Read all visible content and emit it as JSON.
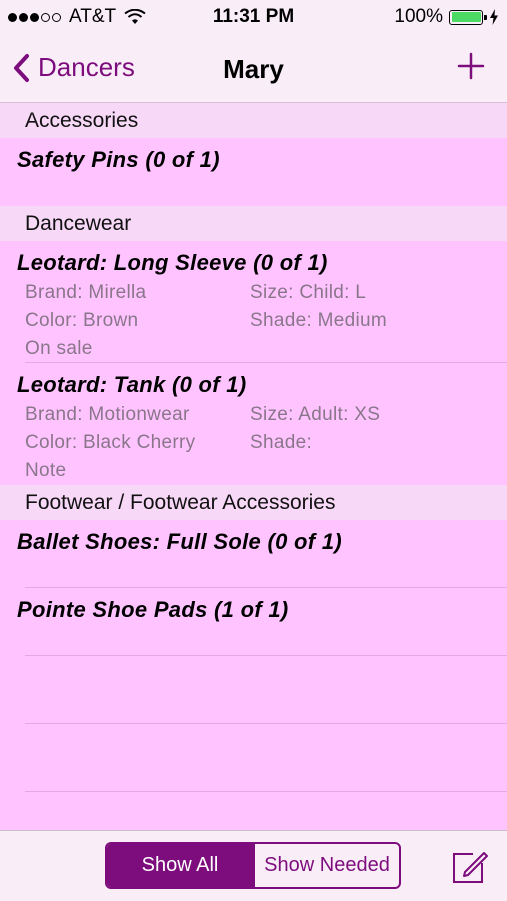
{
  "status_bar": {
    "carrier": "AT&T",
    "time": "11:31 PM",
    "battery": "100%",
    "battery_level": 1.0
  },
  "nav": {
    "back_label": "Dancers",
    "title": "Mary"
  },
  "sections": [
    {
      "header": "Accessories",
      "items": [
        {
          "title": "Safety Pins (0 of 1)"
        }
      ]
    },
    {
      "header": "Dancewear",
      "items": [
        {
          "title": "Leotard: Long Sleeve (0 of 1)",
          "brand": "Brand: Mirella",
          "size": "Size: Child: L",
          "color": "Color: Brown",
          "shade": "Shade: Medium",
          "note": "On sale"
        },
        {
          "title": "Leotard: Tank (0 of 1)",
          "brand": "Brand: Motionwear",
          "size": "Size: Adult: XS",
          "color": "Color: Black Cherry",
          "shade": "Shade:",
          "note": "Note"
        }
      ]
    },
    {
      "header": "Footwear / Footwear Accessories",
      "items": [
        {
          "title": "Ballet Shoes: Full Sole (0 of 1)"
        },
        {
          "title": "Pointe Shoe Pads (1 of 1)"
        }
      ]
    }
  ],
  "toolbar": {
    "show_all": "Show All",
    "show_needed": "Show Needed",
    "selected": "Show All"
  },
  "colors": {
    "accent": "#7d0c7d",
    "background": "#ffc4ff",
    "section_header": "#f7d8f7",
    "detail_text": "#8a768a"
  }
}
